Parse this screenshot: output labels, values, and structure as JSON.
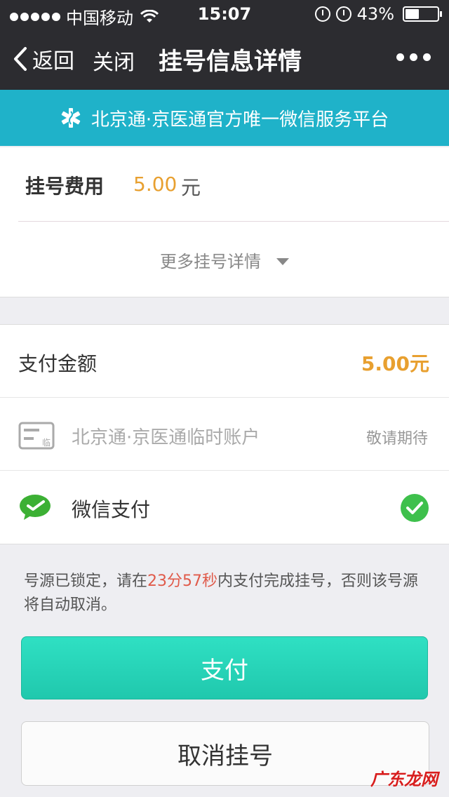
{
  "status_bar": {
    "carrier": "中国移动",
    "time": "15:07",
    "battery": "43%",
    "battery_level": 0.43
  },
  "nav": {
    "back_label": "返回",
    "close_label": "关闭",
    "title": "挂号信息详情"
  },
  "banner": {
    "text": "北京通·京医通官方唯一微信服务平台"
  },
  "fee": {
    "label": "挂号费用",
    "value": "5.00",
    "unit": "元"
  },
  "more_details": {
    "label": "更多挂号详情"
  },
  "payment": {
    "amount_label": "支付金额",
    "amount_value": "5.00元",
    "account_label": "北京通·京医通临时账户",
    "account_icon_text": "临",
    "account_status": "敬请期待",
    "wechat_label": "微信支付"
  },
  "notice": {
    "part1": "号源已锁定，请在",
    "countdown": "23分57秒",
    "part2": "内支付完成挂号，否则该号源将自动取消。"
  },
  "buttons": {
    "pay": "支付",
    "cancel": "取消挂号"
  },
  "watermark": "广东龙网"
}
